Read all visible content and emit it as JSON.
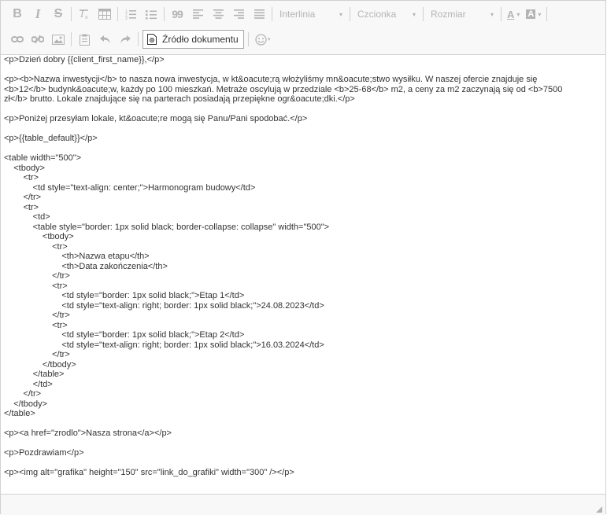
{
  "toolbar": {
    "row1": {
      "bold_label": "B",
      "italic_label": "I",
      "strike_label": "S",
      "clear_format_label": "Ix",
      "quote_label": "99",
      "line_height_label": "Interlinia",
      "font_label": "Czcionka",
      "size_label": "Rozmiar",
      "text_color_label": "A",
      "bg_color_label": "A",
      "dropdown_arrow": "▾"
    },
    "row2": {
      "source_label": "Źródło dokumentu",
      "emoji_arrow": "▾"
    }
  },
  "content": {
    "lines": [
      "<p>Dzień dobry {{client_first_name}},</p>",
      "",
      "<p><b>Nazwa inwestycji</b> to nasza nowa inwestycja, w kt&oacute;rą włożyliśmy mn&oacute;stwo wysiłku. W naszej ofercie znajduje się",
      "<b>12</b> budynk&oacute;w, każdy po 100 mieszkań. Metraże oscylują w przedziale <b>25-68</b> m2, a ceny za m2 zaczynają się od <b>7500",
      "zł</b> brutto. Lokale znajdujące się na parterach posiadają przepiękne ogr&oacute;dki.</p>",
      "",
      "<p>Poniżej przesyłam lokale, kt&oacute;re mogą się Panu/Pani spodobać.</p>",
      "",
      "<p>{{table_default}}</p>",
      "",
      "<table width=\"500\">",
      "    <tbody>",
      "        <tr>",
      "            <td style=\"text-align: center;\">Harmonogram budowy</td>",
      "        </tr>",
      "        <tr>",
      "            <td>",
      "            <table style=\"border: 1px solid black; border-collapse: collapse\" width=\"500\">",
      "                <tbody>",
      "                    <tr>",
      "                        <th>Nazwa etapu</th>",
      "                        <th>Data zakończenia</th>",
      "                    </tr>",
      "                    <tr>",
      "                        <td style=\"border: 1px solid black;\">Etap 1</td>",
      "                        <td style=\"text-align: right; border: 1px solid black;\">24.08.2023</td>",
      "                    </tr>",
      "                    <tr>",
      "                        <td style=\"border: 1px solid black;\">Etap 2</td>",
      "                        <td style=\"text-align: right; border: 1px solid black;\">16.03.2024</td>",
      "                    </tr>",
      "                </tbody>",
      "            </table>",
      "            </td>",
      "        </tr>",
      "    </tbody>",
      "</table>",
      "",
      "<p><a href=\"zrodlo\">Nasza strona</a></p>",
      "",
      "<p>Pozdrawiam</p>",
      "",
      "<p><img alt=\"grafika\" height=\"150\" src=\"link_do_grafiki\" width=\"300\" /></p>"
    ]
  },
  "colors": {
    "toolbar_bg": "#f8f8f8",
    "border": "#d1d1d1",
    "icon_disabled": "#b4b4b4",
    "text": "#333333"
  }
}
